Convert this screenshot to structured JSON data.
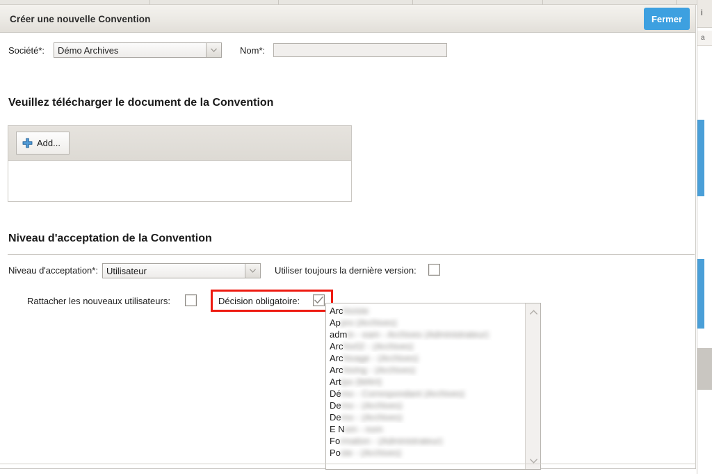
{
  "window": {
    "title": "Créer une nouvelle Convention",
    "close_button_label": "Fermer",
    "accent_color": "#3da0e0",
    "highlight_color": "#ee1b11"
  },
  "form": {
    "societe_label": "Société*:",
    "societe_value": "Démo Archives",
    "nom_label": "Nom*:",
    "nom_value": "",
    "nom_placeholder": ""
  },
  "upload": {
    "heading": "Veuillez télécharger le document de la Convention",
    "add_button_label": "Add...",
    "add_icon": "plus-icon"
  },
  "acceptance": {
    "heading": "Niveau d'acceptation de la Convention",
    "niveau_label": "Niveau d'acceptation*:",
    "niveau_value": "Utilisateur",
    "version_label": "Utiliser toujours la dernière version:",
    "version_checked": false,
    "rattacher_label": "Rattacher les nouveaux utilisateurs:",
    "rattacher_checked": false,
    "decision_label": "Décision obligatoire:",
    "decision_checked": true
  },
  "userlist": {
    "scroll_up_icon": "chevron-up-icon",
    "scroll_down_icon": "chevron-down-icon",
    "items": [
      {
        "prefix": "Arc",
        "redacted": "hiviste"
      },
      {
        "prefix": "Ap",
        "redacted": "pro (Archives)"
      },
      {
        "prefix": "adm",
        "redacted": "in - eam - Archives (Administrateur)"
      },
      {
        "prefix": "Arc",
        "redacted": "hiv02 - (Archives)"
      },
      {
        "prefix": "Arc",
        "redacted": "hivage - (Archives)"
      },
      {
        "prefix": "Arc",
        "redacted": "hiving - (Archives)"
      },
      {
        "prefix": "Art",
        "redacted": "ipo (MAH)"
      },
      {
        "prefix": "Dé",
        "redacted": "mo - Correspondant (Archives)"
      },
      {
        "prefix": "De",
        "redacted": "mo - (Archives)"
      },
      {
        "prefix": "De",
        "redacted": "mo - (Archives)"
      },
      {
        "prefix": "E N",
        "redacted": "om - nom"
      },
      {
        "prefix": "Fo",
        "redacted": "rmation - (Administrateur)"
      },
      {
        "prefix": "Po",
        "redacted": "ste - (Archives)"
      }
    ]
  },
  "background": {
    "tab_divider_positions": [
      215,
      400,
      593,
      780,
      972
    ],
    "sliver_top_letter": "i",
    "sliver_second_letter": "a"
  }
}
